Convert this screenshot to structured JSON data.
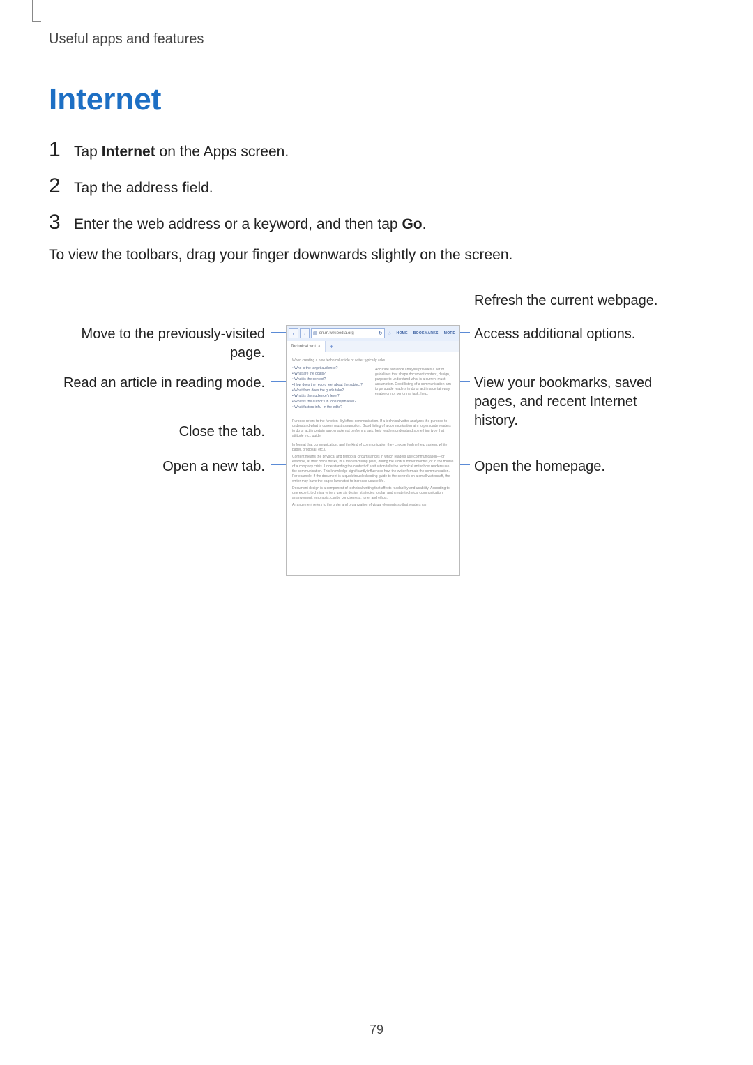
{
  "breadcrumb": "Useful apps and features",
  "title": "Internet",
  "steps": [
    {
      "num": "1",
      "prefix": "Tap ",
      "bold": "Internet",
      "suffix": " on the Apps screen."
    },
    {
      "num": "2",
      "prefix": "Tap the address field.",
      "bold": "",
      "suffix": ""
    },
    {
      "num": "3",
      "prefix": "Enter the web address or a keyword, and then tap ",
      "bold": "Go",
      "suffix": "."
    }
  ],
  "note": "To view the toolbars, drag your finger downwards slightly on the screen.",
  "labels": {
    "left": {
      "prev": "Move to the previously-visited page.",
      "reading": "Read an article in reading mode.",
      "close": "Close the tab.",
      "newtab": "Open a new tab."
    },
    "right": {
      "refresh": "Refresh the current webpage.",
      "options": "Access additional options.",
      "bookmarks": "View your bookmarks, saved pages, and recent Internet history.",
      "home": "Open the homepage."
    }
  },
  "mock": {
    "url": "en.m.wikipedia.org",
    "toolbar_links": [
      "HOME",
      "BOOKMARKS",
      "MORE"
    ],
    "tab_label": "Technical writ",
    "tab_close": "×",
    "tab_plus": "+",
    "intro": "When creating a new technical article or writer typically asks",
    "questions": [
      "Who is the target audience?",
      "What are the goals?",
      "What is the context?",
      "How does the record feel about the subject?",
      "What form does the guide take?",
      "What is the audience's level?",
      "What is the author's in tone depth level?",
      "What factors influ- in the edits?"
    ],
    "para1": "Accurate audience analysis provides a set of guidelines that shape document content, design, purpose to understand what is a current must assumption. Good listing of a communication aim to persuade readers to do or act in a certain way, enable or not perform a task; help.",
    "para2": "Purpose refers to the function- lity/effect communication. If a technical writer analyzes the purpose to understand what is current must assumption. Good listing of a communication aim to persuade readers to do or act in certain way, enable not perform a task; help readers understand something type that attitude etc., guide.",
    "para3": "In format that communication, and the kind of communication they choose (online help system, white paper, proposal, etc.).",
    "para4": "Content means the physical and temporal circumstances in which readers use communication—for example, at their office desks, in a manufacturing plant, during the slow summer months, or in the middle of a company crisis. Understanding the context of a situation tells the technical writer how readers use the communication. This knowledge significantly influences how the writer formats the communication. For example, if the document is a quick troubleshooting guide to the controls on a small watercraft, the writer may have the pages laminated to increase usable life.",
    "para5": "Document design is a component of technical writing that affects readability and usability. According to one expert, technical writers use six design strategies to plan and create technical communication: arrangement, emphasis, clarity, conciseness, tone, and ethos.",
    "para6": "Arrangement refers to the order and organization of visual elements so that readers can"
  },
  "page_number": "79"
}
